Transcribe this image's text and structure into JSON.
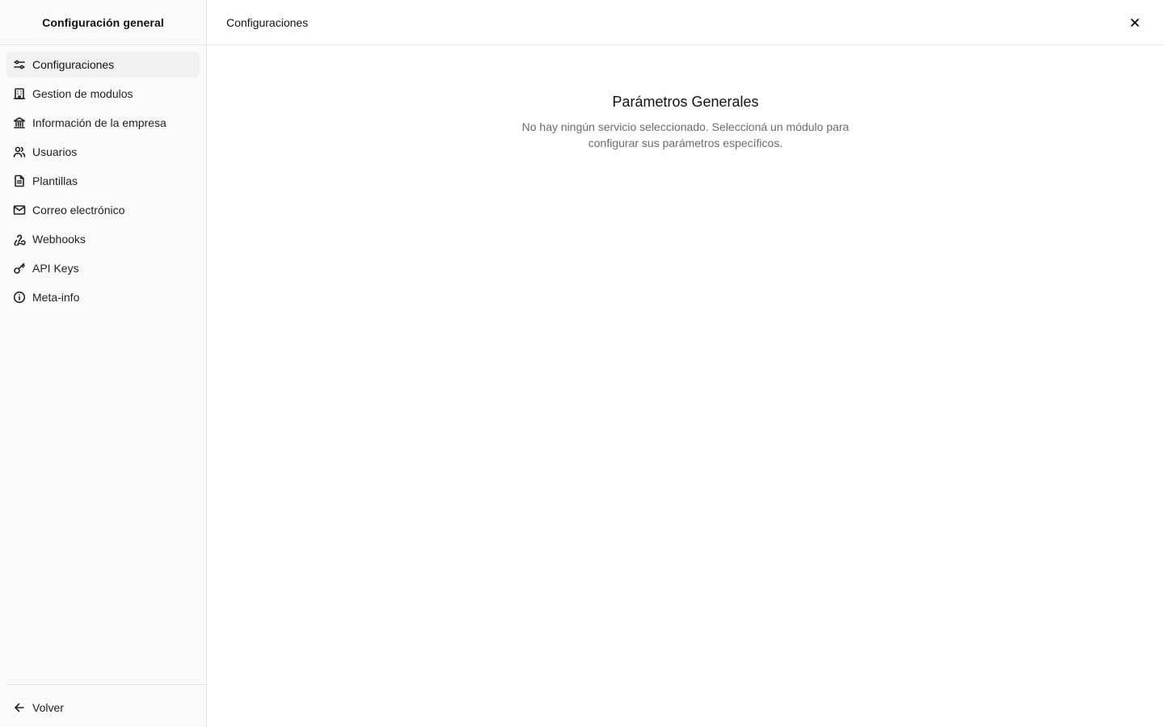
{
  "sidebar": {
    "title": "Configuración general",
    "items": [
      {
        "label": "Configuraciones",
        "icon": "sliders-icon",
        "active": true
      },
      {
        "label": "Gestion de modulos",
        "icon": "building-icon"
      },
      {
        "label": "Información de la empresa",
        "icon": "landmark-icon"
      },
      {
        "label": "Usuarios",
        "icon": "users-icon"
      },
      {
        "label": "Plantillas",
        "icon": "file-text-icon"
      },
      {
        "label": "Correo electrónico",
        "icon": "mail-icon"
      },
      {
        "label": "Webhooks",
        "icon": "webhook-icon"
      },
      {
        "label": "API Keys",
        "icon": "key-icon"
      },
      {
        "label": "Meta-info",
        "icon": "info-icon"
      }
    ],
    "footer": {
      "label": "Volver",
      "icon": "arrow-left-icon"
    }
  },
  "header": {
    "title": "Configuraciones",
    "close_icon": "close-icon"
  },
  "main": {
    "title": "Parámetros Generales",
    "description": "No hay ningún servicio seleccionado. Seleccioná un módulo para configurar sus parámetros específicos."
  },
  "colors": {
    "sidebar_bg": "#fafafa",
    "active_bg": "#f1f1f1",
    "border": "#e7e7e7",
    "muted_text": "#6b6b6b"
  }
}
